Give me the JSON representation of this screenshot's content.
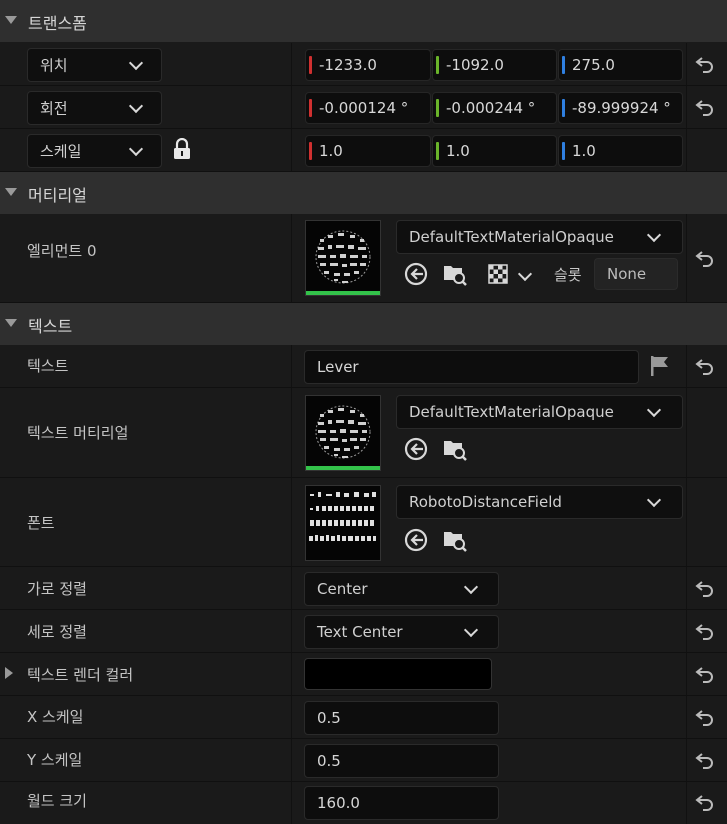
{
  "transform": {
    "title": "트랜스폼",
    "location": {
      "label": "위치",
      "x": "-1233.0",
      "y": "-1092.0",
      "z": "275.0"
    },
    "rotation": {
      "label": "회전",
      "x": "-0.000124 °",
      "y": "-0.000244 °",
      "z": "-89.999924 °"
    },
    "scale": {
      "label": "스케일",
      "x": "1.0",
      "y": "1.0",
      "z": "1.0"
    }
  },
  "materials": {
    "title": "머티리얼",
    "element0": {
      "label": "엘리먼트 0",
      "material": "DefaultTextMaterialOpaque",
      "slot_label": "슬롯",
      "slot_value": "None"
    }
  },
  "text": {
    "title": "텍스트",
    "text_field": {
      "label": "텍스트",
      "value": "Lever"
    },
    "text_material": {
      "label": "텍스트 머티리얼",
      "value": "DefaultTextMaterialOpaque"
    },
    "font": {
      "label": "폰트",
      "value": "RobotoDistanceField"
    },
    "h_align": {
      "label": "가로 정렬",
      "value": "Center"
    },
    "v_align": {
      "label": "세로 정렬",
      "value": "Text Center"
    },
    "render_color": {
      "label": "텍스트 렌더 컬러",
      "color": "#000000"
    },
    "x_scale": {
      "label": "X 스케일",
      "value": "0.5"
    },
    "y_scale": {
      "label": "Y 스케일",
      "value": "0.5"
    },
    "world_size": {
      "label": "월드 크기",
      "value": "160.0"
    }
  },
  "colors": {
    "x_axis": "#d03030",
    "y_axis": "#6ab42a",
    "z_axis": "#2f7fe0",
    "thumb_ok": "#33c24a"
  }
}
